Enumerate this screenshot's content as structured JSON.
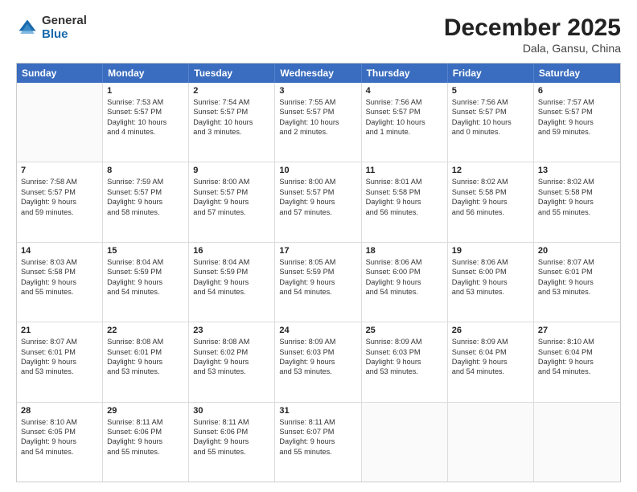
{
  "header": {
    "logo_general": "General",
    "logo_blue": "Blue",
    "month_year": "December 2025",
    "location": "Dala, Gansu, China"
  },
  "weekdays": [
    "Sunday",
    "Monday",
    "Tuesday",
    "Wednesday",
    "Thursday",
    "Friday",
    "Saturday"
  ],
  "rows": [
    [
      {
        "day": "",
        "lines": []
      },
      {
        "day": "1",
        "lines": [
          "Sunrise: 7:53 AM",
          "Sunset: 5:57 PM",
          "Daylight: 10 hours",
          "and 4 minutes."
        ]
      },
      {
        "day": "2",
        "lines": [
          "Sunrise: 7:54 AM",
          "Sunset: 5:57 PM",
          "Daylight: 10 hours",
          "and 3 minutes."
        ]
      },
      {
        "day": "3",
        "lines": [
          "Sunrise: 7:55 AM",
          "Sunset: 5:57 PM",
          "Daylight: 10 hours",
          "and 2 minutes."
        ]
      },
      {
        "day": "4",
        "lines": [
          "Sunrise: 7:56 AM",
          "Sunset: 5:57 PM",
          "Daylight: 10 hours",
          "and 1 minute."
        ]
      },
      {
        "day": "5",
        "lines": [
          "Sunrise: 7:56 AM",
          "Sunset: 5:57 PM",
          "Daylight: 10 hours",
          "and 0 minutes."
        ]
      },
      {
        "day": "6",
        "lines": [
          "Sunrise: 7:57 AM",
          "Sunset: 5:57 PM",
          "Daylight: 9 hours",
          "and 59 minutes."
        ]
      }
    ],
    [
      {
        "day": "7",
        "lines": [
          "Sunrise: 7:58 AM",
          "Sunset: 5:57 PM",
          "Daylight: 9 hours",
          "and 59 minutes."
        ]
      },
      {
        "day": "8",
        "lines": [
          "Sunrise: 7:59 AM",
          "Sunset: 5:57 PM",
          "Daylight: 9 hours",
          "and 58 minutes."
        ]
      },
      {
        "day": "9",
        "lines": [
          "Sunrise: 8:00 AM",
          "Sunset: 5:57 PM",
          "Daylight: 9 hours",
          "and 57 minutes."
        ]
      },
      {
        "day": "10",
        "lines": [
          "Sunrise: 8:00 AM",
          "Sunset: 5:57 PM",
          "Daylight: 9 hours",
          "and 57 minutes."
        ]
      },
      {
        "day": "11",
        "lines": [
          "Sunrise: 8:01 AM",
          "Sunset: 5:58 PM",
          "Daylight: 9 hours",
          "and 56 minutes."
        ]
      },
      {
        "day": "12",
        "lines": [
          "Sunrise: 8:02 AM",
          "Sunset: 5:58 PM",
          "Daylight: 9 hours",
          "and 56 minutes."
        ]
      },
      {
        "day": "13",
        "lines": [
          "Sunrise: 8:02 AM",
          "Sunset: 5:58 PM",
          "Daylight: 9 hours",
          "and 55 minutes."
        ]
      }
    ],
    [
      {
        "day": "14",
        "lines": [
          "Sunrise: 8:03 AM",
          "Sunset: 5:58 PM",
          "Daylight: 9 hours",
          "and 55 minutes."
        ]
      },
      {
        "day": "15",
        "lines": [
          "Sunrise: 8:04 AM",
          "Sunset: 5:59 PM",
          "Daylight: 9 hours",
          "and 54 minutes."
        ]
      },
      {
        "day": "16",
        "lines": [
          "Sunrise: 8:04 AM",
          "Sunset: 5:59 PM",
          "Daylight: 9 hours",
          "and 54 minutes."
        ]
      },
      {
        "day": "17",
        "lines": [
          "Sunrise: 8:05 AM",
          "Sunset: 5:59 PM",
          "Daylight: 9 hours",
          "and 54 minutes."
        ]
      },
      {
        "day": "18",
        "lines": [
          "Sunrise: 8:06 AM",
          "Sunset: 6:00 PM",
          "Daylight: 9 hours",
          "and 54 minutes."
        ]
      },
      {
        "day": "19",
        "lines": [
          "Sunrise: 8:06 AM",
          "Sunset: 6:00 PM",
          "Daylight: 9 hours",
          "and 53 minutes."
        ]
      },
      {
        "day": "20",
        "lines": [
          "Sunrise: 8:07 AM",
          "Sunset: 6:01 PM",
          "Daylight: 9 hours",
          "and 53 minutes."
        ]
      }
    ],
    [
      {
        "day": "21",
        "lines": [
          "Sunrise: 8:07 AM",
          "Sunset: 6:01 PM",
          "Daylight: 9 hours",
          "and 53 minutes."
        ]
      },
      {
        "day": "22",
        "lines": [
          "Sunrise: 8:08 AM",
          "Sunset: 6:01 PM",
          "Daylight: 9 hours",
          "and 53 minutes."
        ]
      },
      {
        "day": "23",
        "lines": [
          "Sunrise: 8:08 AM",
          "Sunset: 6:02 PM",
          "Daylight: 9 hours",
          "and 53 minutes."
        ]
      },
      {
        "day": "24",
        "lines": [
          "Sunrise: 8:09 AM",
          "Sunset: 6:03 PM",
          "Daylight: 9 hours",
          "and 53 minutes."
        ]
      },
      {
        "day": "25",
        "lines": [
          "Sunrise: 8:09 AM",
          "Sunset: 6:03 PM",
          "Daylight: 9 hours",
          "and 53 minutes."
        ]
      },
      {
        "day": "26",
        "lines": [
          "Sunrise: 8:09 AM",
          "Sunset: 6:04 PM",
          "Daylight: 9 hours",
          "and 54 minutes."
        ]
      },
      {
        "day": "27",
        "lines": [
          "Sunrise: 8:10 AM",
          "Sunset: 6:04 PM",
          "Daylight: 9 hours",
          "and 54 minutes."
        ]
      }
    ],
    [
      {
        "day": "28",
        "lines": [
          "Sunrise: 8:10 AM",
          "Sunset: 6:05 PM",
          "Daylight: 9 hours",
          "and 54 minutes."
        ]
      },
      {
        "day": "29",
        "lines": [
          "Sunrise: 8:11 AM",
          "Sunset: 6:06 PM",
          "Daylight: 9 hours",
          "and 55 minutes."
        ]
      },
      {
        "day": "30",
        "lines": [
          "Sunrise: 8:11 AM",
          "Sunset: 6:06 PM",
          "Daylight: 9 hours",
          "and 55 minutes."
        ]
      },
      {
        "day": "31",
        "lines": [
          "Sunrise: 8:11 AM",
          "Sunset: 6:07 PM",
          "Daylight: 9 hours",
          "and 55 minutes."
        ]
      },
      {
        "day": "",
        "lines": []
      },
      {
        "day": "",
        "lines": []
      },
      {
        "day": "",
        "lines": []
      }
    ]
  ]
}
